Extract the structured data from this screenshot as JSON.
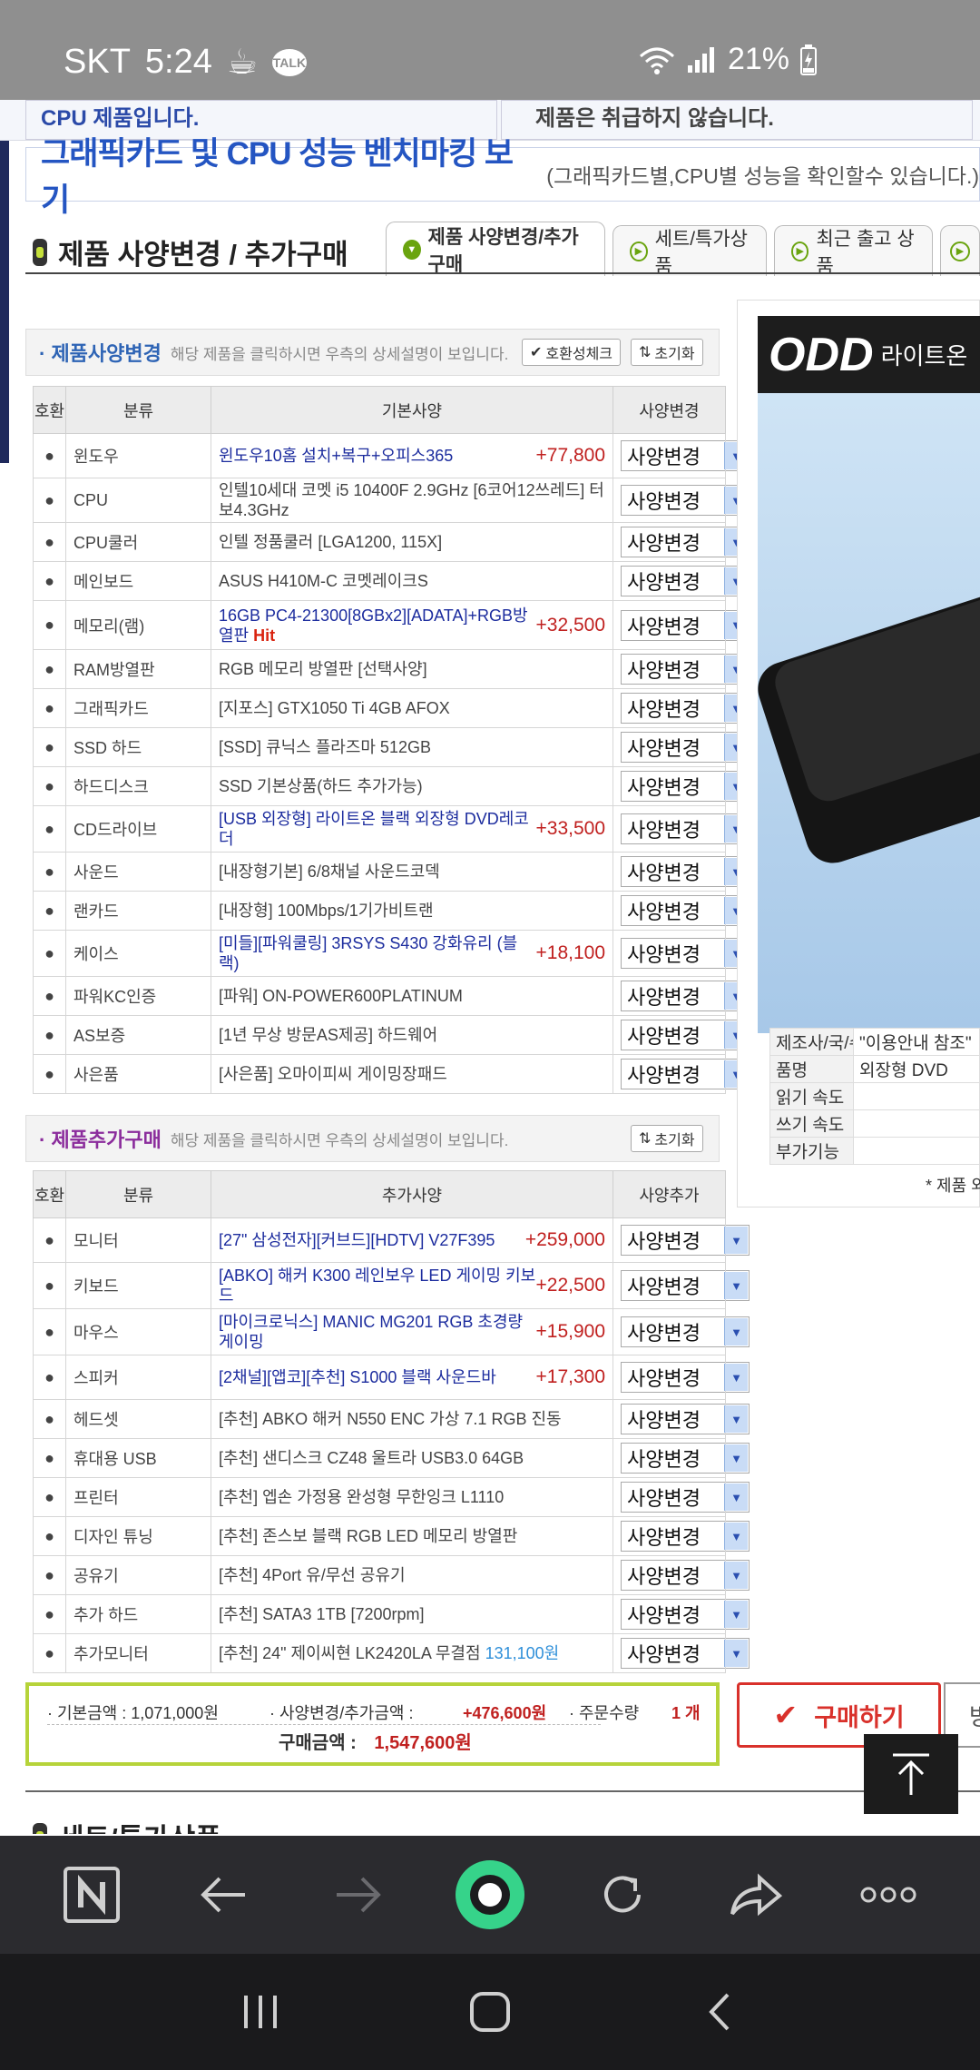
{
  "status_bar": {
    "carrier": "SKT",
    "time": "5:24",
    "talk_label": "TALK",
    "battery": "21%"
  },
  "top_banner": {
    "left": "CPU 제품입니다.",
    "right": "제품은 취급하지 않습니다."
  },
  "benchmark": {
    "title": "그래픽카드 및 CPU 성능 벤치마킹 보기",
    "subtitle": "(그래픽카드별,CPU별 성능을 확인할수 있습니다.)"
  },
  "section": {
    "title": "제품 사양변경 / 추가구매",
    "tabs": [
      {
        "label": "제품 사양변경/추가구매",
        "active": true
      },
      {
        "label": "세트/특가상품",
        "active": false
      },
      {
        "label": "최근 출고 상품",
        "active": false
      }
    ]
  },
  "spec_change": {
    "title": "· 제품사양변경",
    "desc": "해당 제품을 클릭하시면 우측의 상세설명이 보입니다.",
    "btn_compat": "호환성체크",
    "btn_reset": "초기화",
    "headers": [
      "호환",
      "분류",
      "기본사양",
      "사양변경"
    ],
    "rows": [
      {
        "cat": "윈도우",
        "name": "윈도우10홈 설치+복구+오피스365",
        "price": "+77,800"
      },
      {
        "cat": "CPU",
        "name": "인텔10세대 코멧 i5 10400F 2.9GHz [6코어12쓰레드] 터보4.3GHz",
        "price": ""
      },
      {
        "cat": "CPU쿨러",
        "name": "인텔 정품쿨러 [LGA1200, 115X]",
        "price": ""
      },
      {
        "cat": "메인보드",
        "name": "ASUS H410M-C 코멧레이크S",
        "price": ""
      },
      {
        "cat": "메모리(램)",
        "name": "16GB PC4-21300[8GBx2][ADATA]+RGB방열판",
        "hit": "Hit",
        "price": "+32,500"
      },
      {
        "cat": "RAM방열판",
        "name": "RGB 메모리 방열판 [선택사양]",
        "price": ""
      },
      {
        "cat": "그래픽카드",
        "name": "[지포스] GTX1050 Ti 4GB AFOX",
        "price": ""
      },
      {
        "cat": "SSD 하드",
        "name": "[SSD] 큐닉스 플라즈마 512GB",
        "price": ""
      },
      {
        "cat": "하드디스크",
        "name": "SSD 기본상품(하드 추가가능)",
        "price": ""
      },
      {
        "cat": "CD드라이브",
        "name": "[USB 외장형] 라이트온 블랙 외장형 DVD레코더",
        "price": "+33,500"
      },
      {
        "cat": "사운드",
        "name": "[내장형기본] 6/8채널 사운드코덱",
        "price": ""
      },
      {
        "cat": "랜카드",
        "name": "[내장형] 100Mbps/1기가비트랜",
        "price": ""
      },
      {
        "cat": "케이스",
        "name": "[미들][파워쿨링] 3RSYS S430 강화유리 (블랙)",
        "price": "+18,100"
      },
      {
        "cat": "파워KC인증",
        "name": "[파워] ON-POWER600PLATINUM",
        "price": ""
      },
      {
        "cat": "AS보증",
        "name": "[1년 무상 방문AS제공] 하드웨어",
        "price": ""
      },
      {
        "cat": "사은품",
        "name": "[사은품] 오마이피씨 게이밍장패드",
        "price": ""
      }
    ],
    "select_label": "사양변경"
  },
  "add_purchase": {
    "title": "· 제품추가구매",
    "desc": "해당 제품을 클릭하시면 우측의 상세설명이 보입니다.",
    "btn_reset": "초기화",
    "headers": [
      "호환",
      "분류",
      "추가사양",
      "사양추가"
    ],
    "rows": [
      {
        "cat": "모니터",
        "name": "[27\" 삼성전자][커브드][HDTV] V27F395",
        "price": "+259,000"
      },
      {
        "cat": "키보드",
        "name": "[ABKO] 해커 K300 레인보우 LED 게이밍 키보드",
        "price": "+22,500"
      },
      {
        "cat": "마우스",
        "name": "[마이크로닉스] MANIC MG201 RGB 초경량 게이밍",
        "price": "+15,900"
      },
      {
        "cat": "스피커",
        "name": "[2채널][앱코][추천] S1000 블랙 사운드바",
        "price": "+17,300"
      },
      {
        "cat": "헤드셋",
        "name": "[추천] ABKO 해커 N550 ENC 가상 7.1 RGB 진동",
        "price": ""
      },
      {
        "cat": "휴대용 USB",
        "name": "[추천] 샌디스크 CZ48 울트라 USB3.0 64GB",
        "price": ""
      },
      {
        "cat": "프린터",
        "name": "[추천] 엡손 가정용 완성형 무한잉크 L1110",
        "price": ""
      },
      {
        "cat": "디자인 튜닝",
        "name": "[추천] 존스보 블랙 RGB LED 메모리 방열판",
        "price": ""
      },
      {
        "cat": "공유기",
        "name": "[추천] 4Port 유/무선 공유기",
        "price": ""
      },
      {
        "cat": "추가 하드",
        "name": "[추천] SATA3 1TB [7200rpm]",
        "price": ""
      },
      {
        "cat": "추가모니터",
        "name": "[추천] 24\" 제이씨현 LK2420LA 무결점",
        "extra": "131,100원",
        "price": ""
      }
    ],
    "select_label": "사양변경"
  },
  "ad": {
    "brand": "ODD",
    "brand_sub": "라이트온",
    "specs": [
      {
        "k": "제조사/국/수입",
        "v": "\"이용안내 참조\""
      },
      {
        "k": "품명",
        "v": "외장형 DVD"
      },
      {
        "k": "읽기 속도",
        "v": ""
      },
      {
        "k": "쓰기 속도",
        "v": ""
      },
      {
        "k": "부가기능",
        "v": ""
      }
    ],
    "note": "* 제품 외"
  },
  "totals": {
    "base_label": "· 기본금액 : 1,071,000원",
    "change_label": "· 사양변경/추가금액 :",
    "change_value": "+476,600원",
    "qty_label": "· 주문수량",
    "qty_value": "1 개",
    "total_label": "구매금액 :",
    "total_value": "1,547,600원"
  },
  "buy_button": "구매하기",
  "buy_button2": "방",
  "section2_title": "세트/특가상품"
}
